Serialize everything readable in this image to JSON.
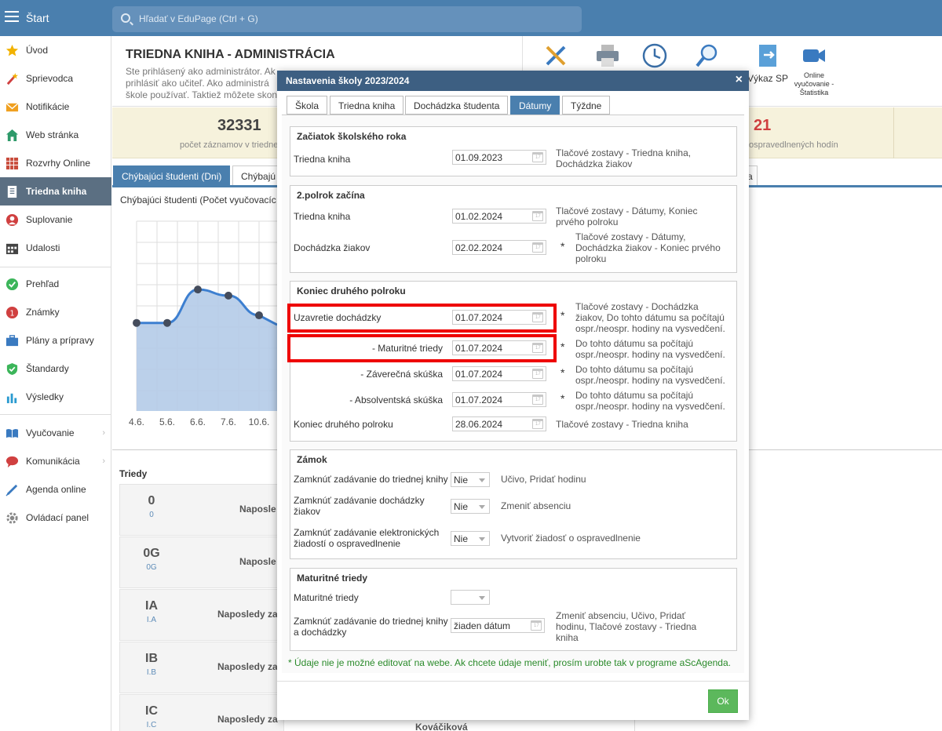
{
  "topbar": {
    "start_label": "Štart",
    "search_placeholder": "Hľadať v EduPage (Ctrl + G)"
  },
  "sidebar": {
    "items": [
      {
        "label": "Úvod",
        "icon": "star-icon",
        "color": "#f2b200"
      },
      {
        "label": "Sprievodca",
        "icon": "wand-icon",
        "color": "#d04040"
      },
      {
        "label": "Notifikácie",
        "icon": "envelope-icon",
        "color": "#f0a020"
      },
      {
        "label": "Web stránka",
        "icon": "house-icon",
        "color": "#2e9a6a"
      },
      {
        "label": "Rozvrhy Online",
        "icon": "grid-icon",
        "color": "#c84a3a"
      },
      {
        "label": "Triedna kniha",
        "icon": "book-icon",
        "color": "#ffffff"
      },
      {
        "label": "Suplovanie",
        "icon": "person-icon",
        "color": "#d04040"
      },
      {
        "label": "Udalosti",
        "icon": "calendar-icon",
        "color": "#444444"
      },
      {
        "label": "Prehľad",
        "icon": "check-icon",
        "color": "#3cb55a"
      },
      {
        "label": "Známky",
        "icon": "grade-icon",
        "color": "#d04040"
      },
      {
        "label": "Plány a prípravy",
        "icon": "briefcase-icon",
        "color": "#3a7ac0"
      },
      {
        "label": "Štandardy",
        "icon": "shield-icon",
        "color": "#3cb55a"
      },
      {
        "label": "Výsledky",
        "icon": "bar-chart-icon",
        "color": "#2a9ad0"
      },
      {
        "label": "Vyučovanie",
        "icon": "open-book-icon",
        "color": "#3a7ac0"
      },
      {
        "label": "Komunikácia",
        "icon": "chat-icon",
        "color": "#d04040"
      },
      {
        "label": "Agenda online",
        "icon": "pen-icon",
        "color": "#3a7ac0"
      },
      {
        "label": "Ovládací panel",
        "icon": "gear-icon",
        "color": "#888888"
      }
    ]
  },
  "page": {
    "title": "TRIEDNA KNIHA - ADMINISTRÁCIA",
    "desc_line1": "Ste prihlásený ako administrátor. Ak",
    "desc_line2": "prihlásiť ako učiteľ. Ako administrá",
    "desc_line3": "škole používať. Taktiež môžete skon",
    "tool_vykaz": "Výkaz SP",
    "tool_online_1": "Online",
    "tool_online_2": "vyučovanie -",
    "tool_online_3": "Štatistika",
    "stat1_num": "32331",
    "stat1_lbl": "počet záznamov v triedne",
    "stat2_num": "21",
    "stat2_lbl": "ospravedlnených hodín",
    "tab1": "Chýbajúci študenti (Dni)",
    "tab2": "Chýbajú",
    "tab3": "a",
    "chart_title": "Chýbajúci študenti (Počet vyučovacíc",
    "triedy_label": "Triedy",
    "classes": [
      {
        "name": "0",
        "sub": "0",
        "last": "Naposle"
      },
      {
        "name": "0G",
        "sub": "0G",
        "last": "Naposle"
      },
      {
        "name": "IA",
        "sub": "I.A",
        "last": "Naposledy za"
      },
      {
        "name": "IB",
        "sub": "I.B",
        "last": "Naposledy za"
      },
      {
        "name": "IC",
        "sub": "I.C",
        "last": "Naposledy za"
      }
    ],
    "bottom_name": "Kováčiková"
  },
  "chart_data": {
    "type": "area",
    "categories": [
      "4.6.",
      "5.6.",
      "6.6.",
      "7.6.",
      "10.6."
    ],
    "values": [
      58,
      58,
      80,
      76,
      63
    ],
    "ylim": [
      0,
      200
    ],
    "grid": true
  },
  "dialog": {
    "title": "Nastavenia školy 2023/2024",
    "tabs": [
      "Škola",
      "Triedna kniha",
      "Dochádzka študenta",
      "Dátumy",
      "Týždne"
    ],
    "s1": {
      "title": "Začiatok školského roka",
      "label": "Triedna kniha",
      "date": "01.09.2023",
      "note1": "Tlačové zostavy - Triedna kniha,",
      "note2": "Dochádzka žiakov"
    },
    "s2": {
      "title": "2.polrok začína",
      "r1_label": "Triedna kniha",
      "r1_date": "01.02.2024",
      "r1_note1": "Tlačové zostavy - Dátumy, Koniec",
      "r1_note2": "prvého polroku",
      "r2_label": "Dochádzka žiakov",
      "r2_date": "02.02.2024",
      "r2_star": "*",
      "r2_note1": "Tlačové zostavy - Dátumy,",
      "r2_note2": "Dochádzka žiakov - Koniec prvého",
      "r2_note3": "polroku"
    },
    "s3": {
      "title": "Koniec druhého polroku",
      "r1_label": "Uzavretie dochádzky",
      "r1_date": "01.07.2024",
      "r1_note1": "Tlačové zostavy - Dochádzka",
      "r1_note2": "žiakov, Do tohto dátumu sa počítajú",
      "r1_note3": "ospr./neospr. hodiny na vysvedčení.",
      "r2_label": "- Maturitné triedy",
      "r2_date": "01.07.2024",
      "r3_label": "- Záverečná skúška",
      "r3_date": "01.07.2024",
      "r4_label": "- Absolventská skúška",
      "r4_date": "01.07.2024",
      "sub_note1": "Do tohto dátumu sa počítajú",
      "sub_note2": "ospr./neospr. hodiny na vysvedčení.",
      "r5_label": "Koniec druhého polroku",
      "r5_date": "28.06.2024",
      "r5_note": "Tlačové zostavy - Triedna kniha",
      "star": "*"
    },
    "s4": {
      "title": "Zámok",
      "r1_label": "Zamknúť zadávanie do triednej knihy",
      "r1_value": "Nie",
      "r1_note": "Učivo, Pridať hodinu",
      "r2_label1": "Zamknúť zadávanie dochádzky",
      "r2_label2": "žiakov",
      "r2_value": "Nie",
      "r2_note": "Zmeniť absenciu",
      "r3_label1": "Zamknúť zadávanie elektronických",
      "r3_label2": "žiadostí o ospravedlnenie",
      "r3_value": "Nie",
      "r3_note": "Vytvoriť žiadosť o ospravedlnenie"
    },
    "s5": {
      "title": "Maturitné triedy",
      "r1_label": "Maturitné triedy",
      "r2_label1": "Zamknúť zadávanie do triednej knihy",
      "r2_label2": "a dochádzky",
      "r2_value": "žiaden dátum",
      "r2_note1": "Zmeniť absenciu, Učivo, Pridať",
      "r2_note2": "hodinu, Tlačové zostavy - Triedna",
      "r2_note3": "kniha"
    },
    "footnote": "* Údaje nie je možné editovať na webe. Ak chcete údaje meniť, prosím urobte tak v programe aScAgenda.",
    "ok_label": "Ok"
  }
}
